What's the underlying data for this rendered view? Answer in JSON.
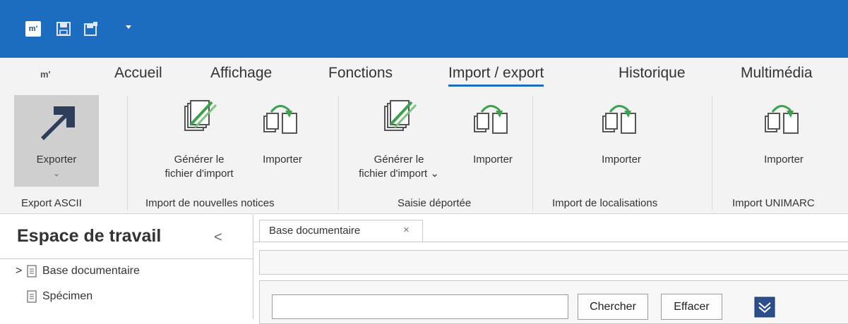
{
  "quick_access": {
    "logo": "m'"
  },
  "tabs": [
    {
      "label": "m'"
    },
    {
      "label": "Accueil"
    },
    {
      "label": "Affichage"
    },
    {
      "label": "Fonctions"
    },
    {
      "label": "Import / export"
    },
    {
      "label": "Historique"
    },
    {
      "label": "Multimédia"
    }
  ],
  "ribbon": {
    "export": {
      "label": "Exporter",
      "chevron": "⌄",
      "group": "Export ASCII"
    },
    "g2": {
      "gen": [
        "Générer le",
        "fichier d'import"
      ],
      "imp": "Importer",
      "group": "Import de nouvelles notices"
    },
    "g3": {
      "gen": [
        "Générer le",
        "fichier d'import ⌄"
      ],
      "imp": "Importer",
      "group": "Saisie déportée"
    },
    "g4": {
      "imp": "Importer",
      "group": "Import de localisations"
    },
    "g5": {
      "imp": "Importer",
      "group": "Import UNIMARC"
    }
  },
  "workspace": {
    "title": "Espace de travail",
    "collapse": "<",
    "items": [
      {
        "label": "Base documentaire",
        "expand": ">"
      },
      {
        "label": "Spécimen",
        "expand": ""
      }
    ]
  },
  "document": {
    "tab": {
      "label": "Base documentaire",
      "close": "×"
    },
    "search": {
      "value": "",
      "search_label": "Chercher",
      "clear_label": "Effacer"
    }
  },
  "colors": {
    "accent": "#1c6cc0",
    "arrow": "#2c3e5a",
    "green": "#39a24b"
  }
}
